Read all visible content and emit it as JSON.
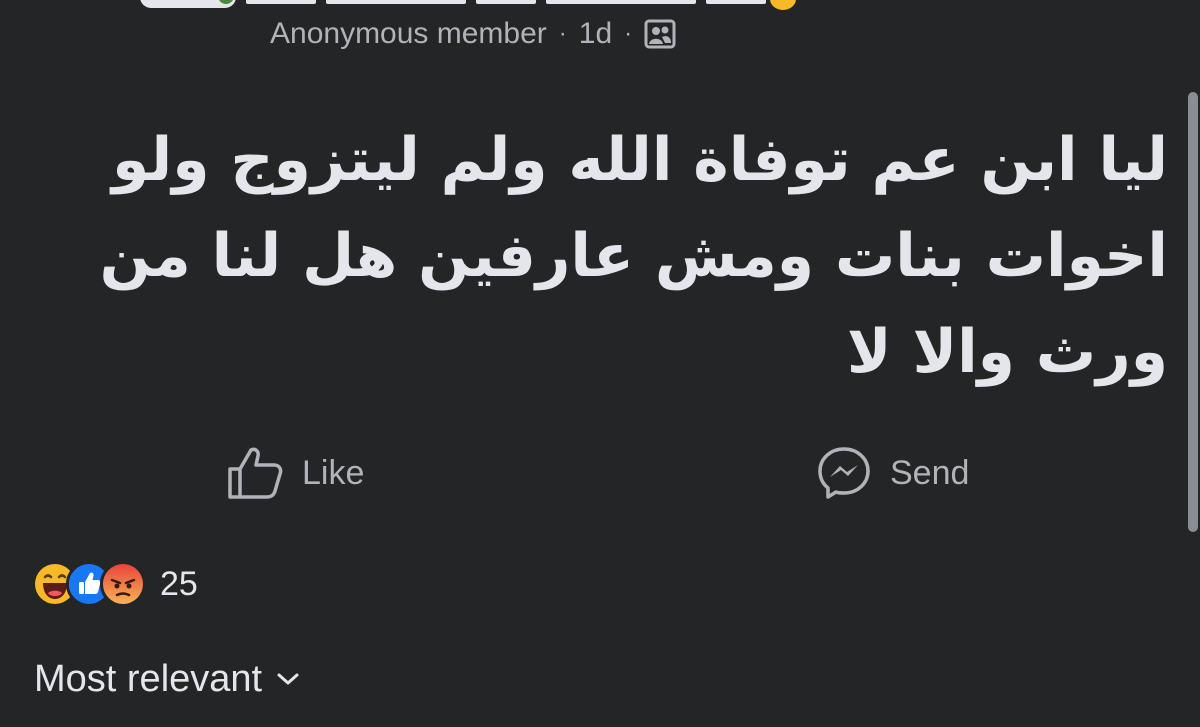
{
  "post": {
    "author_meta": {
      "author_label": "Anonymous member",
      "separator": "·",
      "time": "1d",
      "audience_icon": "group-icon"
    },
    "text": "ليا ابن عم توفاة الله ولم ليتزوج ولو اخوات بنات ومش عارفين هل لنا من ورث والا لا"
  },
  "actions": {
    "like_label": "Like",
    "like_icon": "thumbs-up-icon",
    "send_label": "Send",
    "send_icon": "messenger-icon"
  },
  "reactions": {
    "icons": [
      "haha-icon",
      "like-icon",
      "angry-icon"
    ],
    "count": "25"
  },
  "sort": {
    "label": "Most relevant",
    "icon": "chevron-down-icon"
  },
  "colors": {
    "background": "#242526",
    "primary_text": "#e4e6eb",
    "secondary_text": "#b0b3b8",
    "like_blue": "#1877f2",
    "haha_yellow": "#f7b928",
    "angry_red": "#e9443a"
  }
}
